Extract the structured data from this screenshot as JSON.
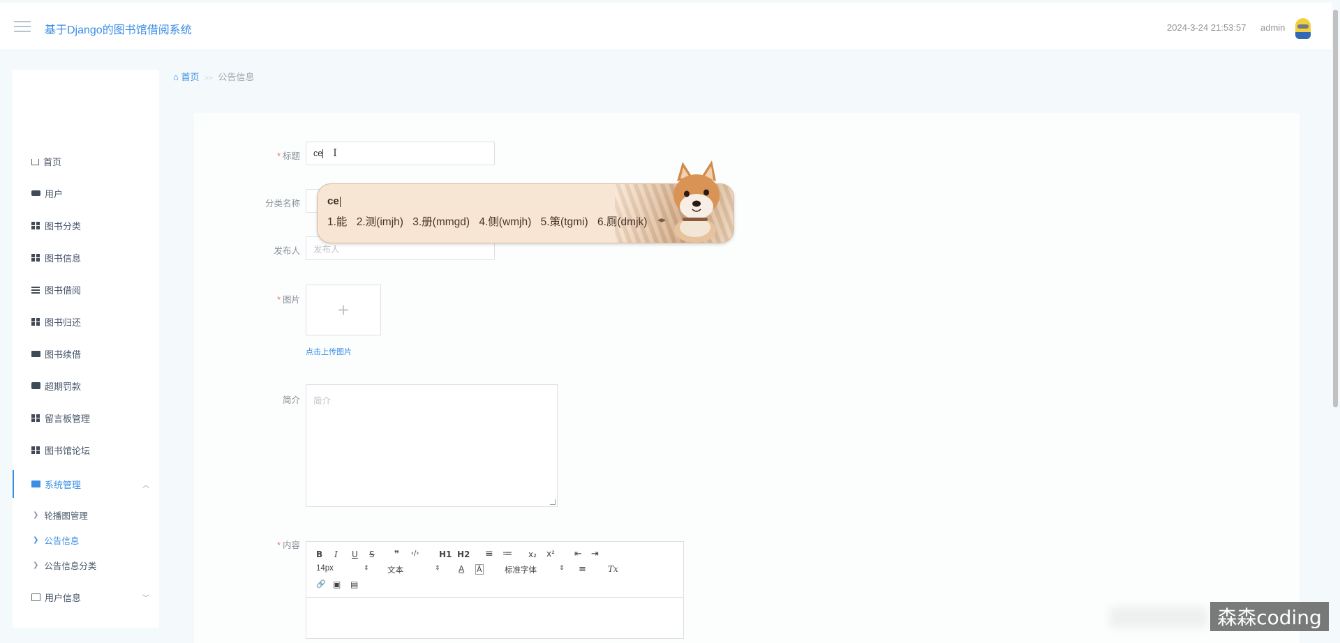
{
  "header": {
    "app_title": "基于Django的图书馆借阅系统",
    "datetime": "2024-3-24 21:53:57",
    "username": "admin"
  },
  "sidebar": {
    "items": [
      {
        "label": "首页",
        "icon": "home-icon"
      },
      {
        "label": "用户",
        "icon": "users-icon"
      },
      {
        "label": "图书分类",
        "icon": "grid-icon"
      },
      {
        "label": "图书信息",
        "icon": "grid-icon"
      },
      {
        "label": "图书借阅",
        "icon": "list-icon"
      },
      {
        "label": "图书归还",
        "icon": "grid-icon"
      },
      {
        "label": "图书续借",
        "icon": "monitor-icon"
      },
      {
        "label": "超期罚款",
        "icon": "chat-icon"
      },
      {
        "label": "留言板管理",
        "icon": "grid-icon"
      },
      {
        "label": "图书馆论坛",
        "icon": "grid-icon"
      },
      {
        "label": "系统管理",
        "icon": "folder-icon"
      },
      {
        "label": "用户信息",
        "icon": "card-icon"
      }
    ],
    "sub_items": [
      {
        "label": "轮播图管理"
      },
      {
        "label": "公告信息"
      },
      {
        "label": "公告信息分类"
      }
    ]
  },
  "breadcrumb": {
    "home": "首页",
    "separator": ">>",
    "current": "公告信息"
  },
  "form": {
    "title_label": "标题",
    "title_value": "ce",
    "category_label": "分类名称",
    "publisher_label": "发布人",
    "publisher_placeholder": "发布人",
    "image_label": "图片",
    "upload_plus": "+",
    "upload_hint": "点击上传图片",
    "intro_label": "简介",
    "intro_placeholder": "简介",
    "content_label": "内容",
    "required_mark": "*"
  },
  "editor": {
    "font_size": "14px",
    "text_style": "文本",
    "font_family": "标准字体",
    "buttons": [
      "B",
      "I",
      "U",
      "S",
      "❞",
      "‹/›",
      "H1",
      "H2",
      "≡",
      "≔",
      "x₂",
      "x²",
      "⇤",
      "⇥",
      "A",
      "Ā",
      "≡",
      "Tx",
      "🔗",
      "▣",
      "▤"
    ]
  },
  "ime": {
    "pinyin": "ce",
    "candidates": [
      "1.能",
      "2.测(imjh)",
      "3.册(mmgd)",
      "4.侧(wmjh)",
      "5.策(tgmi)",
      "6.厕(dmjk)"
    ]
  },
  "watermark": "森森coding"
}
